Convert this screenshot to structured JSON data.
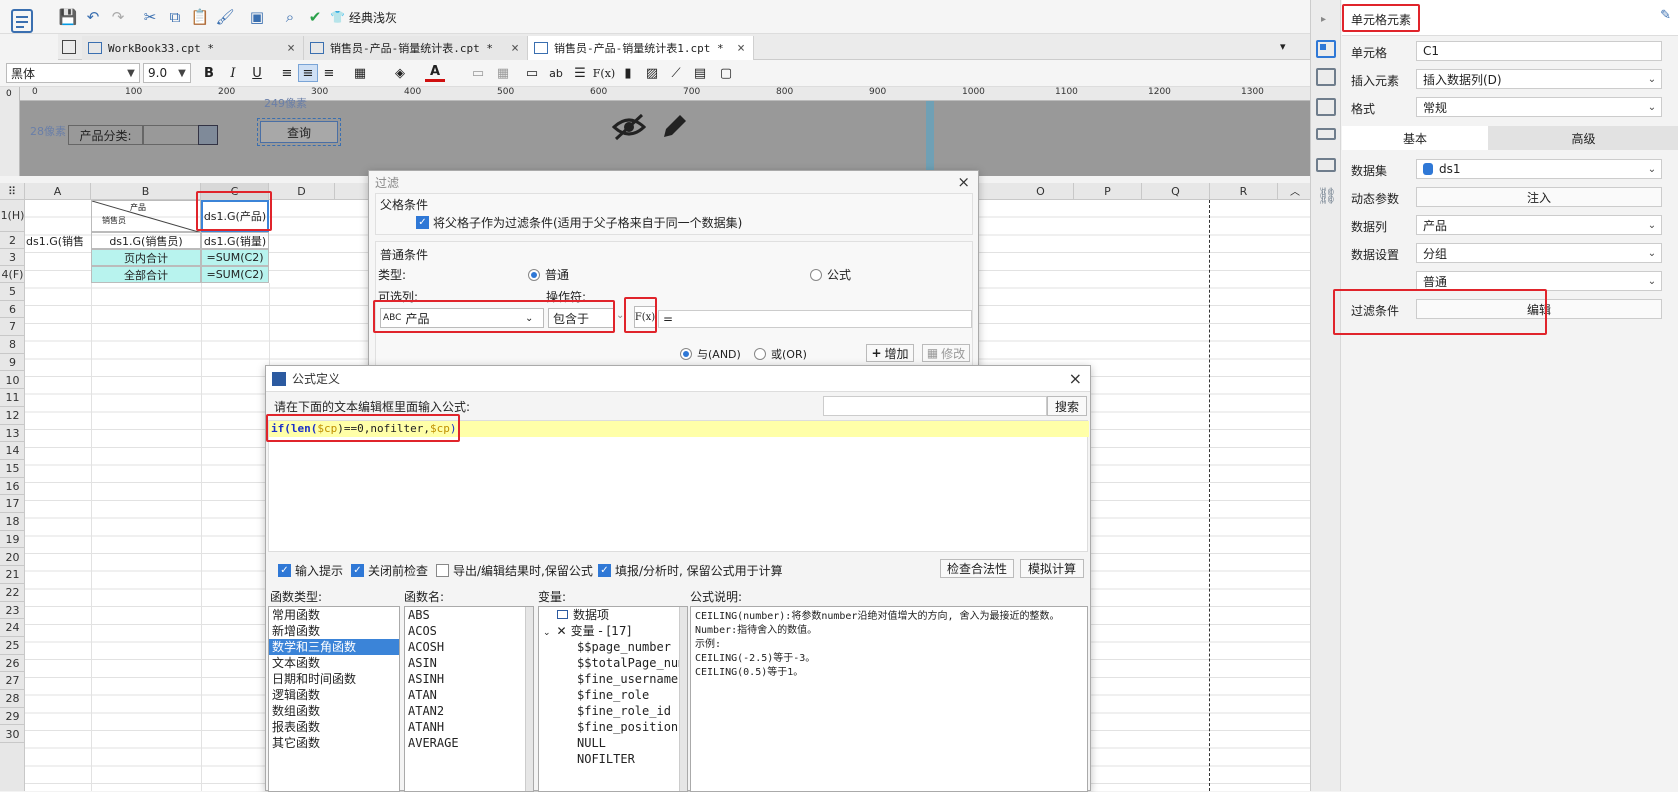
{
  "toolbar": {
    "classic_label": "经典浅灰"
  },
  "tabs": [
    {
      "label": "WorkBook33.cpt *",
      "close": "×"
    },
    {
      "label": "销售员-产品-销量统计表.cpt *",
      "close": "×"
    },
    {
      "label": "销售员-产品-销量统计表1.cpt *",
      "close": "×"
    }
  ],
  "format_bar": {
    "font": "黑体",
    "size": "9.0",
    "bold": "B",
    "italic": "I",
    "underline": "U"
  },
  "ruler_ticks": [
    "0",
    "100",
    "200",
    "300",
    "400",
    "500",
    "600",
    "700",
    "800",
    "900",
    "1000",
    "1100",
    "1200",
    "1300"
  ],
  "param_area": {
    "width_label": "249像素",
    "height_label": "28像素",
    "category_label": "产品分类:",
    "query_button": "查询"
  },
  "columns": [
    "A",
    "B",
    "C",
    "D",
    "O",
    "P",
    "Q",
    "R"
  ],
  "rows": [
    "1(H)",
    "2",
    "3",
    "4(F)",
    "5",
    "6",
    "7",
    "8",
    "9",
    "10",
    "11",
    "12",
    "13",
    "14",
    "15",
    "16",
    "17",
    "18",
    "19",
    "20",
    "21",
    "22",
    "23",
    "24",
    "25",
    "26",
    "27",
    "28",
    "29",
    "30"
  ],
  "cells": {
    "b1_top": "产品",
    "b1_bottom": "销售员",
    "c1": "ds1.G(产品)",
    "a2": "ds1.G(销售",
    "b2": "ds1.G(销售员)",
    "c2": "ds1.G(销量)",
    "b3": "页内合计",
    "c3": "=SUM(C2)",
    "b4": "全部合计",
    "c4": "=SUM(C2)"
  },
  "filter_dialog": {
    "title": "过滤",
    "close": "×",
    "parent_section": "父格条件",
    "parent_checkbox": "将父格子作为过滤条件(适用于父子格来自于同一个数据集)",
    "normal_section": "普通条件",
    "type_label": "类型:",
    "type_normal": "普通",
    "type_formula": "公式",
    "column_label": "可选列:",
    "operator_label": "操作符:",
    "column_value": "产品",
    "operator_value": "包含于",
    "fx_label": "F(x)",
    "value_text": "=",
    "and_label": "与(AND)",
    "or_label": "或(OR)",
    "add_button": "增加",
    "modify_button": "修改"
  },
  "formula_dialog": {
    "title": "公式定义",
    "close": "×",
    "prompt": "请在下面的文本编辑框里面输入公式:",
    "search_placeholder": "",
    "search_button": "搜索",
    "formula_if": "if(",
    "formula_len": "len(",
    "formula_var1": "$cp",
    "formula_mid": ")==0,nofilter,",
    "formula_var2": "$cp",
    "formula_end": ")",
    "opt_hint": "输入提示",
    "opt_check_close": "关闭前检查",
    "opt_export": "导出/编辑结果时,保留公式",
    "opt_fill": "填报/分析时, 保留公式用于计算",
    "check_button": "检查合法性",
    "simulate_button": "模拟计算",
    "func_type_label": "函数类型:",
    "func_name_label": "函数名:",
    "var_label": "变量:",
    "desc_label": "公式说明:",
    "func_types": [
      "常用函数",
      "新增函数",
      "数学和三角函数",
      "文本函数",
      "日期和时间函数",
      "逻辑函数",
      "数组函数",
      "报表函数",
      "其它函数"
    ],
    "func_type_selected": 2,
    "func_names": [
      "ABS",
      "ACOS",
      "ACOSH",
      "ASIN",
      "ASINH",
      "ATAN",
      "ATAN2",
      "ATANH",
      "AVERAGE"
    ],
    "var_root": "数据项",
    "var_group": "变量 - [17]",
    "variables": [
      "$$page_number",
      "$$totalPage_number",
      "$fine_username",
      "$fine_role",
      "$fine_role_id",
      "$fine_position",
      "NULL",
      "NOFILTER"
    ],
    "description": [
      "CEILING(number):将参数number沿绝对值增大的方向, 舍入为最接近的整数。",
      "Number:指待舍入的数值。",
      "示例:",
      "CEILING(-2.5)等于-3。",
      "CEILING(0.5)等于1。"
    ]
  },
  "right_panel": {
    "title": "单元格元素",
    "cell_label": "单元格",
    "cell_value": "C1",
    "insert_label": "插入元素",
    "insert_value": "插入数据列(D)",
    "format_label": "格式",
    "format_value": "常规",
    "tab_basic": "基本",
    "tab_advanced": "高级",
    "dataset_label": "数据集",
    "dataset_value": "ds1",
    "dynamic_label": "动态参数",
    "inject_button": "注入",
    "datacol_label": "数据列",
    "datacol_value": "产品",
    "datasetting_label": "数据设置",
    "datasetting_value": "分组",
    "datasetting_sub": "普通",
    "filter_label": "过滤条件",
    "edit_button": "编辑"
  },
  "colors": {
    "highlight": "#e0242b",
    "cyan_cell": "#b8f3ee",
    "selection": "#3b84d8",
    "formula_bg": "#ffffa8"
  }
}
